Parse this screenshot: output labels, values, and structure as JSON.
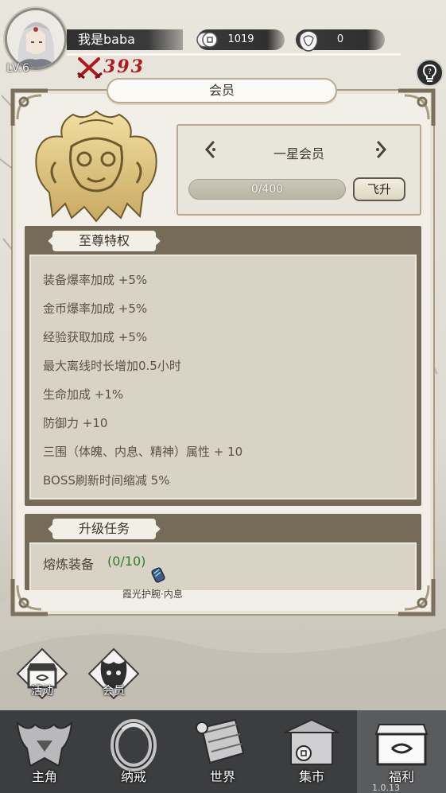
{
  "player": {
    "name": "我是baba",
    "level": "LV.6",
    "power": "393"
  },
  "resources": {
    "coins": "1019",
    "gems": "0"
  },
  "panel": {
    "title": "会员",
    "vip_tier": "一星会员",
    "progress_text": "0/400",
    "progress_fraction": 0,
    "ascend_label": "飞升"
  },
  "privileges": {
    "header": "至尊特权",
    "items": [
      "装备爆率加成 +5%",
      "金币爆率加成 +5%",
      "经验获取加成 +5%",
      "最大离线时长增加0.5小时",
      "生命加成 +1%",
      "防御力 +10",
      "三围（体魄、内息、精神）属性 + 10",
      "BOSS刷新时间缩减 5%"
    ]
  },
  "tasks": {
    "header": "升级任务",
    "task_name": "熔炼装备",
    "task_progress": "(0/10)",
    "item_name": "霞光护腕·内息"
  },
  "shortcuts": {
    "activity": "活动",
    "vip": "会员"
  },
  "nav": {
    "items": [
      "主角",
      "纳戒",
      "世界",
      "集市",
      "福利"
    ],
    "active": "福利"
  },
  "version": "1.0.13",
  "colors": {
    "power": "#b0191c",
    "task_progress": "#2e7d2e",
    "nav_bg": "#3c3d3f"
  }
}
